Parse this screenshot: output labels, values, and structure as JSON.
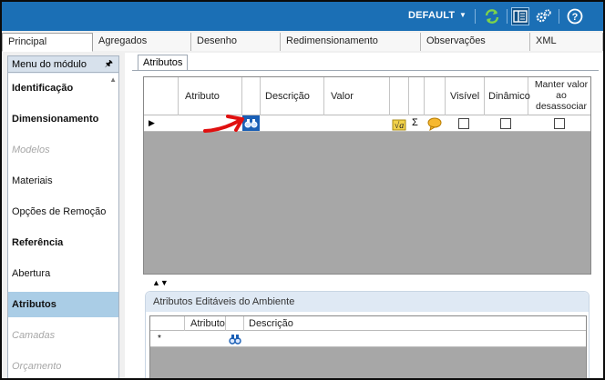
{
  "toolbar": {
    "profile": "DEFAULT",
    "colors": {
      "bar": "#1b6fb5",
      "refresh_icon": "#7dd34a",
      "text": "#ffffff"
    },
    "icons": [
      "refresh-icon",
      "panel-layout-icon",
      "settings-gears-icon",
      "help-icon"
    ]
  },
  "tabs": [
    {
      "label": "Principal",
      "active": true
    },
    {
      "label": "Agregados",
      "active": false
    },
    {
      "label": "Desenho",
      "active": false
    },
    {
      "label": "Redimensionamento",
      "active": false
    },
    {
      "label": "Observações",
      "active": false
    },
    {
      "label": "XML",
      "active": false
    }
  ],
  "sidebar": {
    "title": "Menu do módulo",
    "items": [
      {
        "label": "Identificação",
        "style": "bold"
      },
      {
        "label": "Dimensionamento",
        "style": "bold"
      },
      {
        "label": "Modelos",
        "style": "disabled"
      },
      {
        "label": "Materiais",
        "style": "normal"
      },
      {
        "label": "Opções de Remoção",
        "style": "normal"
      },
      {
        "label": "Referência",
        "style": "bold"
      },
      {
        "label": "Abertura",
        "style": "normal"
      },
      {
        "label": "Atributos",
        "style": "bold-selected"
      },
      {
        "label": "Camadas",
        "style": "disabled"
      },
      {
        "label": "Orçamento",
        "style": "disabled"
      }
    ]
  },
  "content": {
    "subtab": "Atributos",
    "grid_main": {
      "columns": [
        "Atributo",
        "Descrição",
        "Valor",
        "Visível",
        "Dinâmico",
        "Manter valor ao desassociar"
      ],
      "row": {
        "checkboxes": [
          false,
          false,
          false
        ]
      }
    },
    "splitter_glyph": "▲▼",
    "env_panel": {
      "title": "Atributos Editáveis do Ambiente",
      "columns": [
        "Atributo",
        "Descrição"
      ],
      "new_row_marker": "*"
    },
    "sigma": "Σ",
    "arrow_color": "#e01010"
  }
}
